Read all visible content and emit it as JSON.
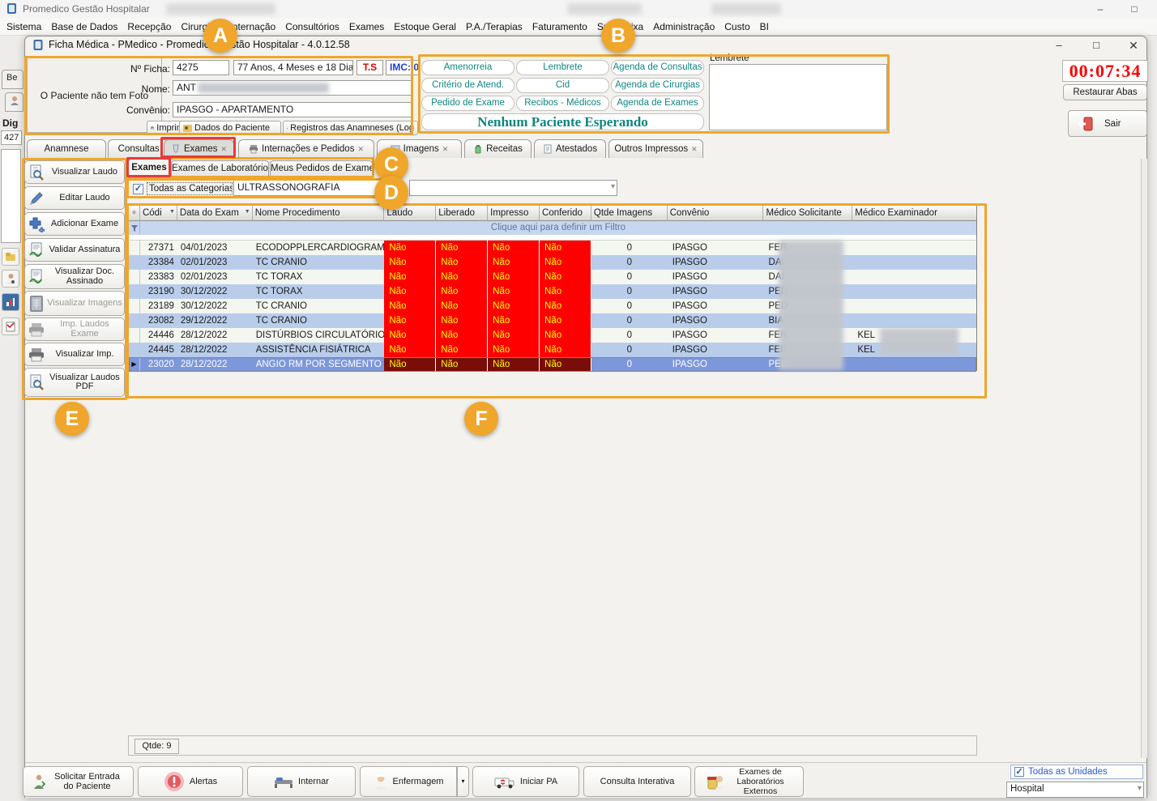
{
  "app": {
    "title": "Promedico Gestão Hospitalar",
    "menu": [
      "Sistema",
      "Base de Dados",
      "Recepção",
      "Cirurgias",
      "Internação",
      "Consultórios",
      "Exames",
      "Estoque Geral",
      "P.A./Terapias",
      "Faturamento",
      "Su",
      "Caixa",
      "Administração",
      "Custo",
      "BI"
    ]
  },
  "background_window": {
    "tab": "Be",
    "dig": "Dig",
    "value": "427"
  },
  "window": {
    "title": "Ficha Médica - PMedico - Promedico Gestão Hospitalar - 4.0.12.58"
  },
  "patient": {
    "no_photo": "O Paciente não tem Foto",
    "ficha_label": "Nº Ficha:",
    "ficha": "4275",
    "idade": "77 Anos, 4 Meses e 18 Dias",
    "ts": "T.S",
    "imc": "IMC: 0",
    "nome_label": "Nome:",
    "nome": "ANT",
    "convenio_label": "Convênio:",
    "convenio": "IPASGO - APARTAMENTO",
    "toolbar": [
      "Imprimir",
      "Dados do Paciente",
      "Registros das Anamneses (Log"
    ]
  },
  "quick": {
    "buttons": [
      "Amenorreia",
      "Lembrete",
      "Agenda de Consultas",
      "Critério de Atend.",
      "Cid",
      "Agenda de Cirurgias",
      "Pedido de Exame",
      "Recibos - Médicos",
      "Agenda de Exames"
    ],
    "waiting": "Nenhum Paciente Esperando",
    "lembrete_label": "Lembrete"
  },
  "session": {
    "timer": "00:07:34",
    "restaurar": "Restaurar Abas",
    "sair": "Sair"
  },
  "tabs": [
    {
      "label": "Anamnese"
    },
    {
      "label": "Consultas",
      "closable": true
    },
    {
      "label": "Exames",
      "closable": true,
      "selected": true
    },
    {
      "label": "Internações e Pedidos",
      "closable": true
    },
    {
      "label": "Imagens",
      "closable": true
    },
    {
      "label": "Receitas"
    },
    {
      "label": "Atestados"
    },
    {
      "label": "Outros Impressos",
      "closable": true
    }
  ],
  "subtabs": [
    "Exames",
    "Exames de Laboratório",
    "Meus Pedidos de Exame"
  ],
  "filter": {
    "todas_categorias": "Todas as Categorias",
    "todas_checked": true,
    "categoria": "ULTRASSONOGRAFIA"
  },
  "sidebar": {
    "items": [
      {
        "label": "Visualizar Laudo",
        "icon": "doc-magnifier-icon"
      },
      {
        "label": "Editar Laudo",
        "icon": "pencil-icon"
      },
      {
        "label": "Adicionar Exame",
        "icon": "plus-icon"
      },
      {
        "label": "Validar Assinatura",
        "icon": "signature-icon"
      },
      {
        "label": "Visualizar Doc. Assinado",
        "icon": "signature-icon"
      },
      {
        "label": "Visualizar Imagens",
        "icon": "xray-icon",
        "disabled": true
      },
      {
        "label": "Imp. Laudos Exame",
        "icon": "printer-icon",
        "disabled": true
      },
      {
        "label": "Visualizar Imp.",
        "icon": "printer-icon"
      },
      {
        "label": "Visualizar Laudos PDF",
        "icon": "doc-magnifier-icon"
      }
    ]
  },
  "table": {
    "columns": [
      "Códi",
      "Data do Exam",
      "Nome Procedimento",
      "Laudo",
      "Liberado",
      "Impresso",
      "Conferido",
      "Qtde Imagens",
      "Convênio",
      "Médico Solicitante",
      "Médico Examinador"
    ],
    "filter_hint": "Clique aqui para definir um Filtro",
    "rows": [
      {
        "codigo": "27371",
        "data": "04/01/2023",
        "nome": "ECODOPPLERCARDIOGRAMA",
        "laudo": "Não",
        "liberado": "Não",
        "impresso": "Não",
        "conferido": "Não",
        "qtde": "0",
        "convenio": "IPASGO",
        "solicitante": "FER",
        "examinador": ""
      },
      {
        "codigo": "23384",
        "data": "02/01/2023",
        "nome": "TC CRANIO",
        "laudo": "Não",
        "liberado": "Não",
        "impresso": "Não",
        "conferido": "Não",
        "qtde": "0",
        "convenio": "IPASGO",
        "solicitante": "DAI",
        "examinador": ""
      },
      {
        "codigo": "23383",
        "data": "02/01/2023",
        "nome": "TC TORAX",
        "laudo": "Não",
        "liberado": "Não",
        "impresso": "Não",
        "conferido": "Não",
        "qtde": "0",
        "convenio": "IPASGO",
        "solicitante": "DAI",
        "examinador": ""
      },
      {
        "codigo": "23190",
        "data": "30/12/2022",
        "nome": "TC TORAX",
        "laudo": "Não",
        "liberado": "Não",
        "impresso": "Não",
        "conferido": "Não",
        "qtde": "0",
        "convenio": "IPASGO",
        "solicitante": "PED",
        "examinador": ""
      },
      {
        "codigo": "23189",
        "data": "30/12/2022",
        "nome": "TC CRANIO",
        "laudo": "Não",
        "liberado": "Não",
        "impresso": "Não",
        "conferido": "Não",
        "qtde": "0",
        "convenio": "IPASGO",
        "solicitante": "PED",
        "examinador": ""
      },
      {
        "codigo": "23082",
        "data": "29/12/2022",
        "nome": "TC CRANIO",
        "laudo": "Não",
        "liberado": "Não",
        "impresso": "Não",
        "conferido": "Não",
        "qtde": "0",
        "convenio": "IPASGO",
        "solicitante": "BIA",
        "examinador": ""
      },
      {
        "codigo": "24446",
        "data": "28/12/2022",
        "nome": "DISTÚRBIOS CIRCULATÓRIOS",
        "laudo": "Não",
        "liberado": "Não",
        "impresso": "Não",
        "conferido": "Não",
        "qtde": "0",
        "convenio": "IPASGO",
        "solicitante": "FER",
        "examinador": "KEL"
      },
      {
        "codigo": "24445",
        "data": "28/12/2022",
        "nome": "ASSISTÊNCIA FISIÁTRICA",
        "laudo": "Não",
        "liberado": "Não",
        "impresso": "Não",
        "conferido": "Não",
        "qtde": "0",
        "convenio": "IPASGO",
        "solicitante": "FER",
        "examinador": "KEL"
      },
      {
        "codigo": "23020",
        "data": "28/12/2022",
        "nome": "ANGIO RM POR SEGMENTO",
        "laudo": "Não",
        "liberado": "Não",
        "impresso": "Não",
        "conferido": "Não",
        "qtde": "0",
        "convenio": "IPASGO",
        "solicitante": "PED",
        "examinador": "",
        "selected": true
      }
    ],
    "qtde": "Qtde: 9"
  },
  "bottom": {
    "buttons": [
      "Solicitar Entrada do Paciente",
      "Alertas",
      "Internar",
      "Enfermagem",
      "Iniciar PA",
      "Consulta Interativa",
      "Exames de Laboratórios Externos"
    ],
    "units_label": "Todas as Unidades",
    "units_checked": true,
    "unit_selected": "Hospital"
  },
  "annotations": {
    "markers": [
      "A",
      "B",
      "C",
      "D",
      "E",
      "F"
    ]
  },
  "ui": {
    "close": "✕",
    "min": "–",
    "restore": "□",
    "dropdown": "▾",
    "check": "✓",
    "row_arrow": "▶",
    "sort": "▼",
    "asterisk": "✳"
  },
  "colors": {
    "annotation_orange": "#EFA62B",
    "highlight_red": "#E53B3B",
    "cell_red": "#FF0000",
    "cell_yellow": "#FFFF00",
    "teal": "#0E8680",
    "selected_row_blue": "#7D97DB",
    "band_blue": "#B9CDEB",
    "timer_red": "#FF0000",
    "selected_no_dark_red": "#7A0D07",
    "units_blue": "#2B5DD7",
    "imc_blue": "#1E3FD0",
    "ts_red": "#E00000"
  }
}
